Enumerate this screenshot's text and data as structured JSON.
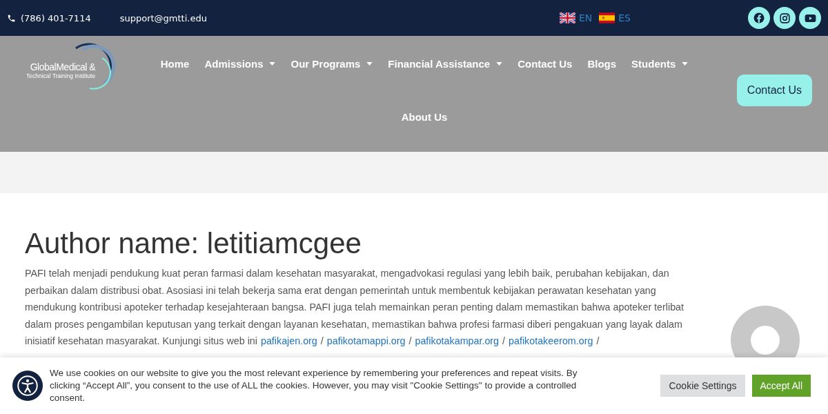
{
  "topbar": {
    "phone": "(786) 401-7114",
    "email": "support@gmtti.edu",
    "languages": [
      {
        "code": "EN",
        "kind": "uk"
      },
      {
        "code": "ES",
        "kind": "es"
      }
    ]
  },
  "logo": {
    "line1": "GlobalMedical &",
    "line2": "Technical Training Institute"
  },
  "nav": [
    {
      "label": "Home",
      "has_menu": false
    },
    {
      "label": "Admissions",
      "has_menu": true
    },
    {
      "label": "Our Programs",
      "has_menu": true
    },
    {
      "label": "Financial Assistance",
      "has_menu": true
    },
    {
      "label": "Contact Us",
      "has_menu": false
    },
    {
      "label": "Blogs",
      "has_menu": false
    },
    {
      "label": "Students",
      "has_menu": true
    },
    {
      "label": "About Us",
      "has_menu": false
    }
  ],
  "header_button": "Contact Us",
  "page_title": "Author name: letitiamcgee",
  "excerpt": {
    "text": "PAFI telah menjadi pendukung kuat peran farmasi dalam kesehatan masyarakat, mengadvokasi regulasi yang lebih baik, perubahan kebijakan, dan perbaikan dalam distribusi obat. Asosiasi ini telah bekerja sama erat dengan pemerintah untuk membentuk kebijakan perawatan kesehatan yang mendukung kontribusi apoteker terhadap kesejahteraan bangsa. PAFI juga telah memainkan peran penting dalam memastikan bahwa apoteker terlibat dalam proses pengambilan keputusan yang terkait dengan layanan kesehatan, memastikan bahwa profesi farmasi diberi pengakuan yang layak dalam inisiatif kesehatan masyarakat. Kunjungi situs web ini",
    "separator": "/",
    "links": [
      "pafikajen.org",
      "pafikotamappi.org",
      "pafikotakampar.org",
      "pafikotakeerom.org"
    ]
  },
  "cookie_banner": {
    "text": "We use cookies on our website to give you the most relevant experience by remembering your preferences and repeat visits. By clicking “Accept All”, you consent to the use of ALL the cookies. However, you may visit \"Cookie Settings\" to provide a controlled consent.",
    "buttons": [
      {
        "label": "Cookie Settings",
        "kind": "secondary"
      },
      {
        "label": "Accept All",
        "kind": "primary"
      }
    ]
  }
}
